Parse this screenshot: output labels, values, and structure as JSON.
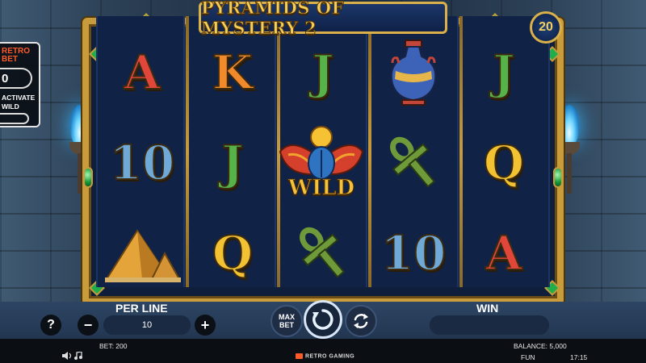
{
  "game": {
    "title": "PYRAMIDS OF MYSTERY 2",
    "lines": "20"
  },
  "promo": {
    "brand": "RETRO BET",
    "value": "0",
    "note": "ACTIVATE WILD"
  },
  "reels": [
    [
      "A",
      "10",
      "pyramid"
    ],
    [
      "K",
      "J",
      "Q"
    ],
    [
      "J",
      "WILD",
      "ankh"
    ],
    [
      "vase",
      "ankh",
      "10"
    ],
    [
      "J",
      "Q",
      "A"
    ]
  ],
  "symbols": {
    "wild_label": "WILD"
  },
  "controls": {
    "help": "?",
    "per_line_label": "PER LINE",
    "per_line_value": "10",
    "minus": "−",
    "plus": "+",
    "max_bet_label": "MAX BET",
    "win_label": "WIN",
    "win_value": ""
  },
  "status": {
    "bet": "BET: 200",
    "balance": "BALANCE: 5,000",
    "mode": "FUN",
    "time": "17:15",
    "provider": "RETRO GAMING"
  },
  "colors": {
    "frame_gold": "#c89b3c",
    "reel_bg": "#102246",
    "gem_green": "#1fae4a",
    "torch_blue": "#35b6ff"
  }
}
